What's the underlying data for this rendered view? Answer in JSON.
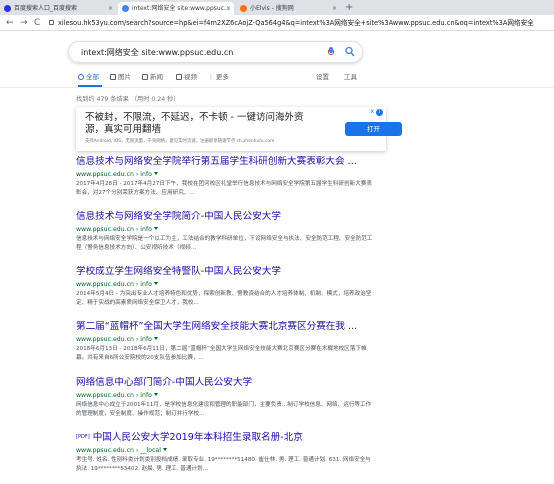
{
  "browser": {
    "tabs": [
      {
        "label": "百度搜索人口_百度搜索",
        "active": false,
        "favicon_color": "#2932e1"
      },
      {
        "label": "intext:网络安全 site:www.ppsuc...",
        "active": true,
        "favicon_color": "#4285f4"
      },
      {
        "label": "小Elvis - 搜狗网",
        "active": false,
        "favicon_color": "#fb6e00"
      }
    ],
    "new_tab": "+",
    "nav": {
      "back": "←",
      "forward": "→",
      "reload": "C"
    },
    "url": "xilesou.hk53yu.com/search?source=hp&ei=f4m2XZ6cAojZ-Qa564g4&q=intext%3A网络安全+site%3Awww.ppsuc.edu.cn&oq=intext%3A网络安全"
  },
  "search": {
    "query": "intext:网络安全 site:www.ppsuc.edu.cn",
    "tabs": [
      {
        "label": "全部",
        "active": true
      },
      {
        "label": "图片",
        "active": false
      },
      {
        "label": "新闻",
        "active": false
      },
      {
        "label": "视频",
        "active": false
      },
      {
        "label": "更多",
        "active": false
      },
      {
        "label": "设置",
        "active": false
      },
      {
        "label": "工具",
        "active": false
      }
    ],
    "stats": "找到约 479 条结果 （用时 0.24 秒）"
  },
  "ad": {
    "headline_1": "不被封，不限流，不延迟，不卡顿 - 一键访问海外资",
    "headline_2": "源，真实可用翻墙",
    "sub": "支持Android, IOS，无限流量，千兆网络，意见实时流速，注册即享随速节点 sh.zhenhufu.com",
    "button": "打开",
    "info": "i",
    "close": "x"
  },
  "results": [
    {
      "title": "信息技术与网络安全学院举行第五届学生科研创新大赛表彰大会 ...",
      "url": "www.ppsuc.edu.cn › info",
      "snippet": "2017年4月28日 - 2017年4月27日下午，我校在团河校区礼堂举行信息技术与网络安全学院第五届学生科研创新大赛表彰会，对27个分别荣获方案方法、应用研究、..."
    },
    {
      "title": "信息技术与网络安全学院简介-中国人民公安大学",
      "url": "www.ppsuc.edu.cn › info",
      "snippet": "信息技术与网络安全学院是一个以工为主，工法结合的教学科研单位，下设网络安全与执法、安全防范工程、安全防范工程（警务信息技术方向）、公安视听技术（视频..."
    },
    {
      "title": "学校成立学生网络安全特警队-中国人民公安大学",
      "url": "www.ppsuc.edu.cn › info",
      "snippet": "2014年5月4日 - 为突出专业人才培养特色和优势，探索创新教、警教资结合的人才培养体制、机制、模式，培养政治坚定、精于实战的高素质网络安全保卫人才，我校..."
    },
    {
      "title": "第二届“蓝帽杯”全国大学生网络安全技能大赛北京赛区分赛在我 ...",
      "url": "www.ppsuc.edu.cn › info",
      "snippet": "2018年6月13日 - 2018年6月11日，第二届“蓝帽杯”全国大学生网络安全技能大赛北京赛区分赛在木樨地校区落下帷幕。共有来自6所公安院校的20支队伍参加比赛，..."
    },
    {
      "title": "网络信息中心部门简介-中国人民公安大学",
      "url": "www.ppsuc.edu.cn › info",
      "snippet": "网络信息中心成立于2001年11月，是学校信息化建设和管理的职能部门，主要负责...制订学校信息、网络、运行等工作的管理制度，安全制度、操作规范；制订并行学校..."
    },
    {
      "pdf": "[PDF]",
      "title": "中国人民公安大学2019年本科招生录取名册-北京",
      "url": "www.ppsuc.edu.cn › __local",
      "snippet": "考生号. 姓名. 性别科类计划类别投档成绩. 录取专业. 19********51480. 崔仕林. 男. 理工. 普通计划. 631. 网络安全与执法. 19********53402. 赵晨. 男. 理工. 普通计划..."
    }
  ],
  "colors": {
    "link": "#1a0dab",
    "url_green": "#006621",
    "accent": "#1a73e8"
  }
}
